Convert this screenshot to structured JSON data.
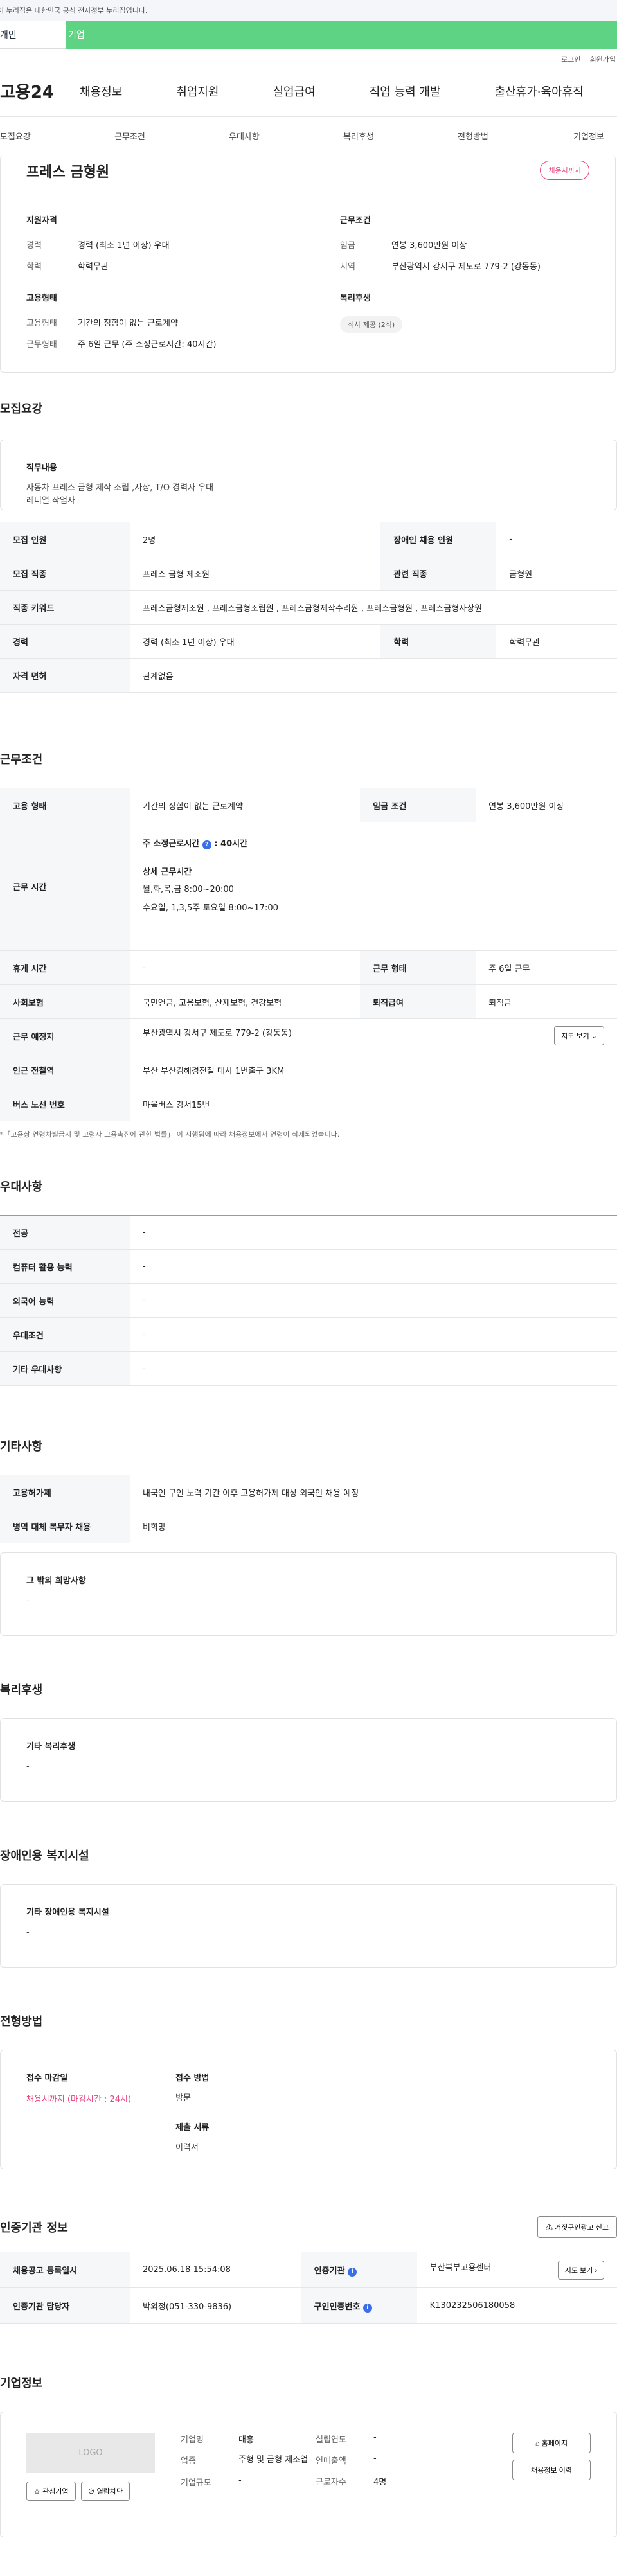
{
  "gov_bar": "이 누리집은 대한민국 공식 전자정부 누리집입니다.",
  "user_tabs": [
    "개인",
    "기업"
  ],
  "util": [
    "로그인",
    "회원가입"
  ],
  "logo": "고용24",
  "gnb": [
    "채용정보",
    "취업지원",
    "실업급여",
    "직업 능력 개발",
    "출산휴가·육아휴직"
  ],
  "lnb": [
    "모집요강",
    "근무조건",
    "우대사항",
    "복리후생",
    "전형방법",
    "기업정보"
  ],
  "hero": {
    "title": "프레스 금형원",
    "status": "채용시까지",
    "qual_h": "지원자격",
    "career_k": "경력",
    "career_v": "경력 (최소 1년 이상) 우대",
    "edu_k": "학력",
    "edu_v": "학력무관",
    "emp_h": "고용형태",
    "emptype_k": "고용형태",
    "emptype_v": "기간의 정함이 없는 근로계약",
    "worktype_k": "근무형태",
    "worktype_v": "주 6일 근무 (주 소정근로시간: 40시간)",
    "cond_h": "근무조건",
    "wage_k": "임금",
    "wage_v": "연봉 3,600만원 이상",
    "loc_k": "지역",
    "loc_v": "부산광역시 강서구 제도로 779-2 (강동동)",
    "welfare_h": "복리후생",
    "welfare_tag": "식사 제공 (2식)"
  },
  "recruit": {
    "title": "모집요강",
    "duty_h": "직무내용",
    "duty_v": "자동차 프레스 금형 제작 조립 ,사상, T/O 경력자 우대\n레디얼 작업자",
    "rows": [
      {
        "k1": "모집 인원",
        "v1": "2명",
        "k2": "장애인 채용 인원",
        "v2": "-"
      },
      {
        "k1": "모집 직종",
        "v1": "프레스 금형 제조원",
        "k2": "관련 직종",
        "v2": "금형원"
      },
      {
        "k1": "직종 키워드",
        "v1": "프레스금형제조원 , 프레스금형조립원 , 프레스금형제작수리원 , 프레스금형원 , 프레스금형사상원"
      },
      {
        "k1": "경력",
        "v1": "경력 (최소 1년 이상) 우대",
        "k2": "학력",
        "v2": "학력무관"
      },
      {
        "k1": "자격 면허",
        "v1": "관계없음"
      }
    ]
  },
  "work": {
    "title": "근무조건",
    "r1": {
      "k1": "고용 형태",
      "v1": "기간의 정함이 없는 근로계약",
      "k2": "임금 조건",
      "v2": "연봉 3,600만원 이상"
    },
    "hours_k": "근무 시간",
    "hours_h1": "주 소정근로시간",
    "hours_h1v": "40시간",
    "hours_h2": "상세 근무시간",
    "hours_l1": "월,화,목,금 8:00~20:00",
    "hours_l2": "수요일, 1,3,5주 토요일 8:00~17:00",
    "r3": {
      "k1": "휴게 시간",
      "v1": "-",
      "k2": "근무 형태",
      "v2": "주 6일 근무"
    },
    "r4": {
      "k1": "사회보험",
      "v1": "국민연금, 고용보험, 산재보험, 건강보험",
      "k2": "퇴직급여",
      "v2": "퇴직금"
    },
    "r5": {
      "k1": "근무 예정지",
      "v1": "부산광역시 강서구 제도로 779-2 (강동동)",
      "btn": "지도 보기"
    },
    "r6": {
      "k1": "인근 전철역",
      "v1": "부산 부산김해경전철 대사 1번출구 3KM"
    },
    "r7": {
      "k1": "버스 노선 번호",
      "v1": "마을버스 강서15번"
    },
    "note": "*「고용상 연령차별금지 및 고령자 고용촉진에 관한 법률」 이 시행됨에 따라 채용정보에서 연령이 삭제되었습니다."
  },
  "pref": {
    "title": "우대사항",
    "rows": [
      {
        "k": "전공",
        "v": "-"
      },
      {
        "k": "컴퓨터 활용 능력",
        "v": "-"
      },
      {
        "k": "외국어 능력",
        "v": "-"
      },
      {
        "k": "우대조건",
        "v": "-"
      },
      {
        "k": "기타 우대사항",
        "v": "-"
      }
    ]
  },
  "etc": {
    "title": "기타사항",
    "r1": {
      "k": "고용허가제",
      "v": "내국인 구인 노력 기간 이후 고용허가제 대상 외국인 채용 예정"
    },
    "r2": {
      "k": "병역 대체 복무자 채용",
      "v": "비희망"
    },
    "box_h": "그 밖의 희망사항",
    "box_v": "-"
  },
  "welfare": {
    "title": "복리후생",
    "box_h": "기타 복리후생",
    "box_v": "-"
  },
  "disabled": {
    "title": "장애인용 복지시설",
    "box_h": "기타 장애인용 복지시설",
    "box_v": "-"
  },
  "select": {
    "title": "전형방법",
    "deadline_h": "접수 마감일",
    "deadline_v": "채용시까지 (마감시간 : 24시)",
    "method_h": "접수 방법",
    "method_v": "방문",
    "docs_h": "제출 서류",
    "docs_v": "이력서"
  },
  "agency": {
    "title": "인증기관 정보",
    "report_btn": "거짓구인광고 신고",
    "r1": {
      "k1": "채용공고 등록일시",
      "v1": "2025.06.18 15:54:08",
      "k2": "인증기관",
      "v2": "부산북부고용센터",
      "btn": "지도 보기"
    },
    "r2": {
      "k1": "인증기관 담당자",
      "v1": "박외정(051-330-9836)",
      "k2": "구인인증번호",
      "v2": "K130232506180058"
    }
  },
  "company": {
    "title": "기업정보",
    "logo": "LOGO",
    "fav_btn": "관심기업",
    "block_btn": "열람차단",
    "name_k": "기업명",
    "name_v": "대흥",
    "ind_k": "업종",
    "ind_v": "주형 및 금형 제조업",
    "size_k": "기업규모",
    "size_v": "-",
    "est_k": "설립연도",
    "est_v": "-",
    "sales_k": "연매출액",
    "sales_v": "-",
    "emp_k": "근로자수",
    "emp_v": "4명",
    "home_btn": "홈페이지",
    "history_btn": "채용정보 이력"
  }
}
